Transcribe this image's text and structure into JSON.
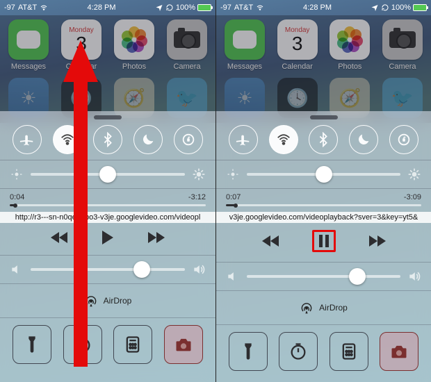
{
  "statusbar": {
    "signal": "-97",
    "carrier": "AT&T",
    "time": "4:28 PM",
    "battery_pct": "100%"
  },
  "home": {
    "apps": [
      {
        "id": "messages",
        "label": "Messages"
      },
      {
        "id": "calendar",
        "label": "Calendar",
        "weekday": "Monday",
        "daynum": "3"
      },
      {
        "id": "photos",
        "label": "Photos"
      },
      {
        "id": "camera",
        "label": "Camera"
      }
    ]
  },
  "control_center_common": {
    "airdrop_label": "AirDrop",
    "brightness_pct": 50,
    "volume_pct": 72
  },
  "left": {
    "elapsed": "0:04",
    "remaining": "-3:12",
    "progress_pct": 3,
    "now_playing": "http://r3---sn-n0qeoapo3-v3je.googlevideo.com/videopl",
    "play_state": "paused"
  },
  "right": {
    "elapsed": "0:07",
    "remaining": "-3:09",
    "progress_pct": 5,
    "now_playing": "v3je.googlevideo.com/videoplayback?sver=3&key=yt5&",
    "play_state": "playing"
  },
  "annotations": {
    "left_gesture": "swipe-up-arrow",
    "right_highlight": "pause-button-highlight"
  }
}
